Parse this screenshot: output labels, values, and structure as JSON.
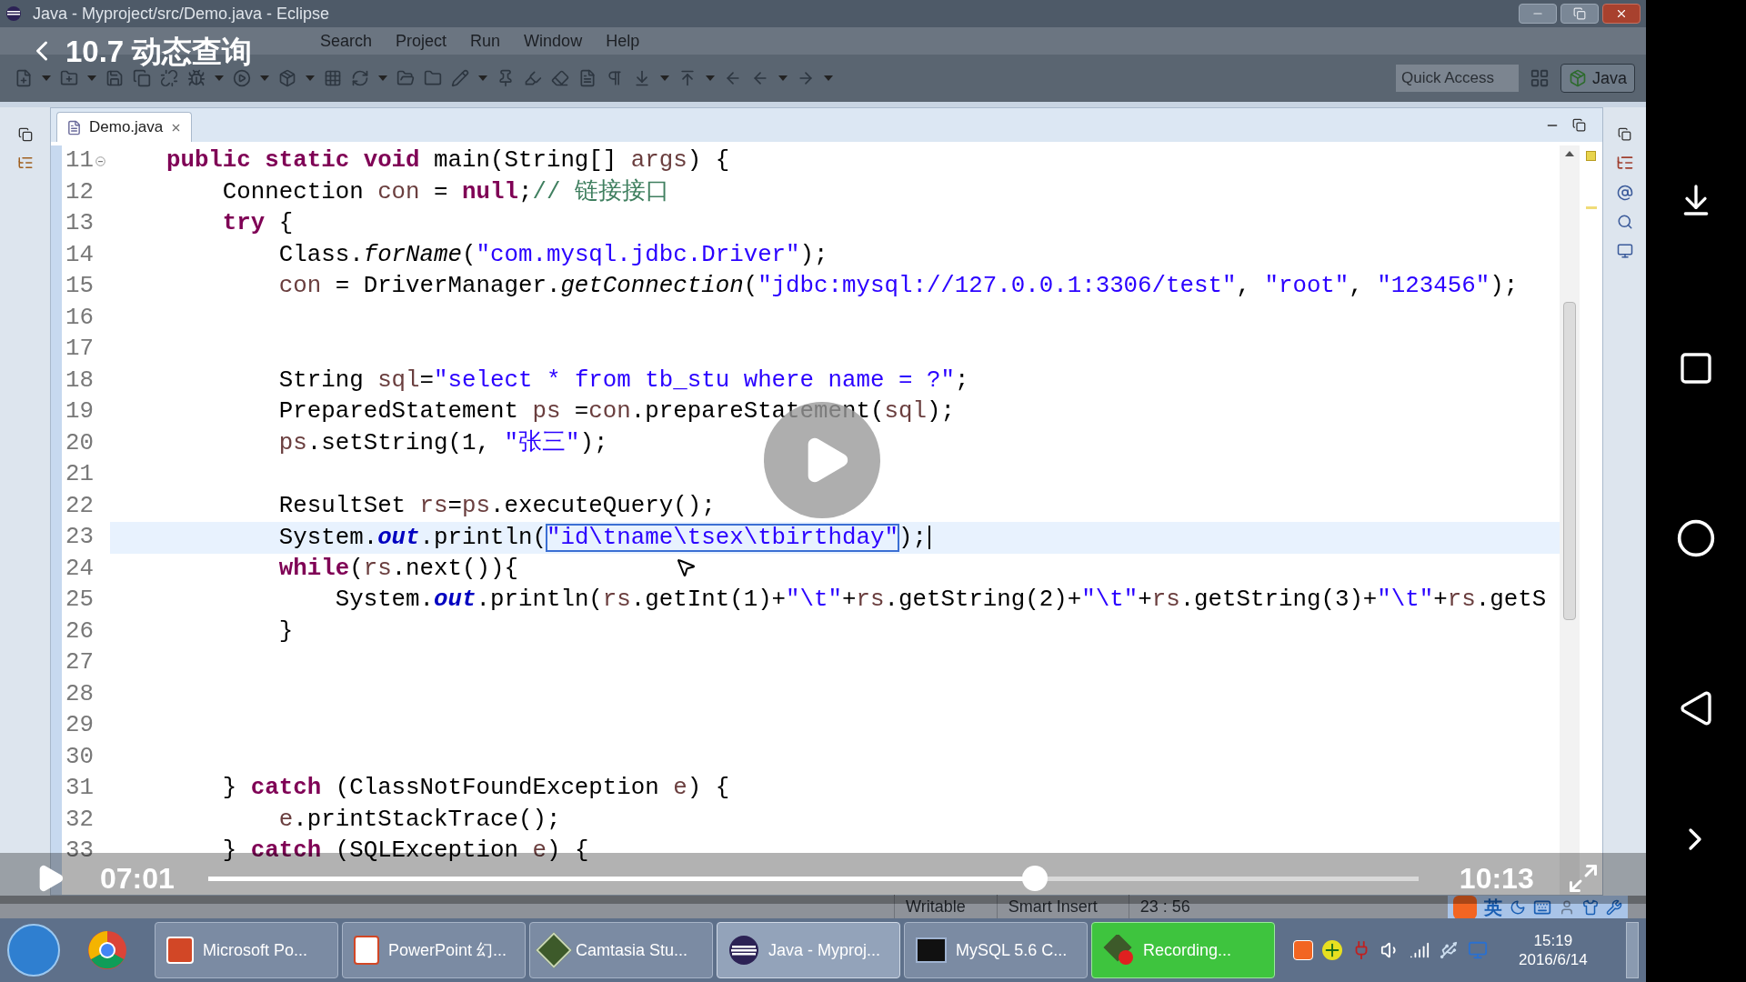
{
  "overlay": {
    "title": "10.7 动态查询"
  },
  "window": {
    "title": "Java - Myproject/src/Demo.java - Eclipse"
  },
  "menu": [
    "Search",
    "Project",
    "Run",
    "Window",
    "Help"
  ],
  "quick_access": {
    "placeholder": "Quick Access"
  },
  "perspective": {
    "label": "Java",
    "selected": true
  },
  "editor": {
    "tab": {
      "label": "Demo.java",
      "selected": true
    },
    "lines": [
      {
        "number": "11",
        "fold": true,
        "current": false,
        "tokens": [
          {
            "kind": "kw",
            "text": "    public static void"
          },
          {
            "kind": "p",
            "text": " main(String[] "
          },
          {
            "kind": "var",
            "text": "args"
          },
          {
            "kind": "p",
            "text": ") {"
          }
        ]
      },
      {
        "number": "12",
        "fold": false,
        "current": false,
        "tokens": [
          {
            "kind": "p",
            "text": "        Connection "
          },
          {
            "kind": "var",
            "text": "con"
          },
          {
            "kind": "p",
            "text": " = "
          },
          {
            "kind": "kw",
            "text": "null"
          },
          {
            "kind": "p",
            "text": ";"
          },
          {
            "kind": "cmt",
            "text": "// 链接接口"
          }
        ]
      },
      {
        "number": "13",
        "fold": false,
        "current": false,
        "tokens": [
          {
            "kind": "kw",
            "text": "        try"
          },
          {
            "kind": "p",
            "text": " {"
          }
        ]
      },
      {
        "number": "14",
        "fold": false,
        "current": false,
        "tokens": [
          {
            "kind": "p",
            "text": "            Class."
          },
          {
            "kind": "it",
            "text": "forName"
          },
          {
            "kind": "p",
            "text": "("
          },
          {
            "kind": "str",
            "text": "\"com.mysql.jdbc.Driver\""
          },
          {
            "kind": "p",
            "text": ");"
          }
        ]
      },
      {
        "number": "15",
        "fold": false,
        "current": false,
        "tokens": [
          {
            "kind": "var",
            "text": "            con"
          },
          {
            "kind": "p",
            "text": " = DriverManager."
          },
          {
            "kind": "it",
            "text": "getConnection"
          },
          {
            "kind": "p",
            "text": "("
          },
          {
            "kind": "str",
            "text": "\"jdbc:mysql://127.0.0.1:3306/test\""
          },
          {
            "kind": "p",
            "text": ", "
          },
          {
            "kind": "str",
            "text": "\"root\""
          },
          {
            "kind": "p",
            "text": ", "
          },
          {
            "kind": "str",
            "text": "\"123456\""
          },
          {
            "kind": "p",
            "text": ");"
          }
        ]
      },
      {
        "number": "16",
        "fold": false,
        "current": false
      },
      {
        "number": "17",
        "fold": false,
        "current": false
      },
      {
        "number": "18",
        "fold": false,
        "current": false,
        "tokens": [
          {
            "kind": "p",
            "text": "            String "
          },
          {
            "kind": "var",
            "text": "sql"
          },
          {
            "kind": "p",
            "text": "="
          },
          {
            "kind": "str",
            "text": "\"select * from tb_stu where name = ?\""
          },
          {
            "kind": "p",
            "text": ";"
          }
        ]
      },
      {
        "number": "19",
        "fold": false,
        "current": false,
        "tokens": [
          {
            "kind": "p",
            "text": "            PreparedStatement "
          },
          {
            "kind": "var",
            "text": "ps"
          },
          {
            "kind": "p",
            "text": " ="
          },
          {
            "kind": "var",
            "text": "con"
          },
          {
            "kind": "p",
            "text": ".prepareStatement("
          },
          {
            "kind": "var",
            "text": "sql"
          },
          {
            "kind": "p",
            "text": ");"
          }
        ]
      },
      {
        "number": "20",
        "fold": false,
        "current": false,
        "tokens": [
          {
            "kind": "var",
            "text": "            ps"
          },
          {
            "kind": "p",
            "text": ".setString(1, "
          },
          {
            "kind": "str",
            "text": "\"张三\""
          },
          {
            "kind": "p",
            "text": ");"
          }
        ]
      },
      {
        "number": "21",
        "fold": false,
        "current": false
      },
      {
        "number": "22",
        "fold": false,
        "current": false,
        "tokens": [
          {
            "kind": "p",
            "text": "            ResultSet "
          },
          {
            "kind": "var",
            "text": "rs"
          },
          {
            "kind": "p",
            "text": "="
          },
          {
            "kind": "var",
            "text": "ps"
          },
          {
            "kind": "p",
            "text": ".executeQuery();"
          }
        ]
      },
      {
        "number": "23",
        "fold": false,
        "current": true,
        "tokens": [
          {
            "kind": "p",
            "text": "            System."
          },
          {
            "kind": "fld",
            "text": "out"
          },
          {
            "kind": "p",
            "text": ".println("
          },
          {
            "kind": "sel",
            "text": "\"id\\tname\\tsex\\tbirthday\""
          },
          {
            "kind": "p",
            "text": ");"
          }
        ]
      },
      {
        "number": "24",
        "fold": false,
        "current": false,
        "tokens": [
          {
            "kind": "kw",
            "text": "            while"
          },
          {
            "kind": "p",
            "text": "("
          },
          {
            "kind": "var",
            "text": "rs"
          },
          {
            "kind": "p",
            "text": ".next()){"
          }
        ]
      },
      {
        "number": "25",
        "fold": false,
        "current": false,
        "tokens": [
          {
            "kind": "p",
            "text": "                System."
          },
          {
            "kind": "fld",
            "text": "out"
          },
          {
            "kind": "p",
            "text": ".println("
          },
          {
            "kind": "var",
            "text": "rs"
          },
          {
            "kind": "p",
            "text": ".getInt(1)+"
          },
          {
            "kind": "str",
            "text": "\"\\t\""
          },
          {
            "kind": "p",
            "text": "+"
          },
          {
            "kind": "var",
            "text": "rs"
          },
          {
            "kind": "p",
            "text": ".getString(2)+"
          },
          {
            "kind": "str",
            "text": "\"\\t\""
          },
          {
            "kind": "p",
            "text": "+"
          },
          {
            "kind": "var",
            "text": "rs"
          },
          {
            "kind": "p",
            "text": ".getString(3)+"
          },
          {
            "kind": "str",
            "text": "\"\\t\""
          },
          {
            "kind": "p",
            "text": "+"
          },
          {
            "kind": "var",
            "text": "rs"
          },
          {
            "kind": "p",
            "text": ".getS"
          }
        ]
      },
      {
        "number": "26",
        "fold": false,
        "current": false,
        "tokens": [
          {
            "kind": "p",
            "text": "            }"
          }
        ]
      },
      {
        "number": "27",
        "fold": false,
        "current": false
      },
      {
        "number": "28",
        "fold": false,
        "current": false
      },
      {
        "number": "29",
        "fold": false,
        "current": false
      },
      {
        "number": "30",
        "fold": false,
        "current": false
      },
      {
        "number": "31",
        "fold": false,
        "current": false,
        "tokens": [
          {
            "kind": "p",
            "text": "        } "
          },
          {
            "kind": "kw",
            "text": "catch"
          },
          {
            "kind": "p",
            "text": " (ClassNotFoundException "
          },
          {
            "kind": "var",
            "text": "e"
          },
          {
            "kind": "p",
            "text": ") {"
          }
        ]
      },
      {
        "number": "32",
        "fold": false,
        "current": false,
        "tokens": [
          {
            "kind": "var",
            "text": "            e"
          },
          {
            "kind": "p",
            "text": ".printStackTrace();"
          }
        ]
      },
      {
        "number": "33",
        "fold": false,
        "current": false,
        "tokens": [
          {
            "kind": "p",
            "text": "        } "
          },
          {
            "kind": "kw",
            "text": "catch"
          },
          {
            "kind": "p",
            "text": " (SQLException "
          },
          {
            "kind": "var",
            "text": "e"
          },
          {
            "kind": "p",
            "text": ") {"
          }
        ]
      }
    ]
  },
  "player": {
    "elapsed": "07:01",
    "duration": "10:13",
    "level": 0.683
  },
  "status_bar": [
    "Writable",
    "Smart Insert",
    "23 : 56"
  ],
  "ime": {
    "language": "英"
  },
  "taskbar": {
    "items": [
      {
        "label": "Microsoft Po...",
        "selected": false,
        "kind": "app"
      },
      {
        "label": "PowerPoint 幻...",
        "selected": false,
        "kind": "app"
      },
      {
        "label": "Camtasia Stu...",
        "selected": false,
        "kind": "app"
      },
      {
        "label": "Java - Myproj...",
        "selected": true,
        "kind": "app"
      },
      {
        "label": "MySQL 5.6 C...",
        "selected": false,
        "kind": "app"
      },
      {
        "label": "Recording...",
        "selected": false,
        "kind": "recording"
      }
    ],
    "time": "15:19",
    "date": "2016/6/14"
  }
}
